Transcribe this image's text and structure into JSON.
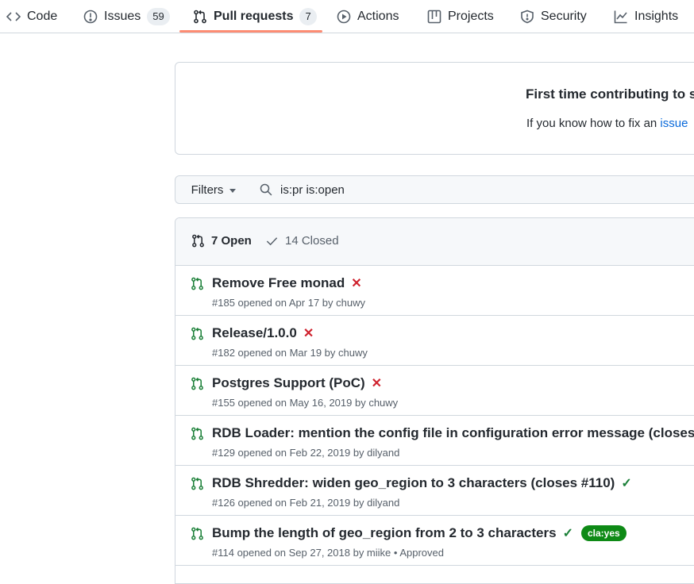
{
  "nav": {
    "tabs": [
      {
        "label": "Code",
        "icon": "code-icon"
      },
      {
        "label": "Issues",
        "icon": "issue-opened-icon",
        "count": "59"
      },
      {
        "label": "Pull requests",
        "icon": "git-pull-request-icon",
        "count": "7",
        "selected": true
      },
      {
        "label": "Actions",
        "icon": "play-icon"
      },
      {
        "label": "Projects",
        "icon": "table-icon"
      },
      {
        "label": "Security",
        "icon": "shield-icon"
      },
      {
        "label": "Insights",
        "icon": "graph-icon"
      }
    ]
  },
  "banner": {
    "title": "First time contributing to s",
    "text_prefix": "If you know how to fix an ",
    "link": "issue"
  },
  "filters": {
    "button_label": "Filters",
    "search_value": "is:pr is:open"
  },
  "list": {
    "open_label": "7 Open",
    "closed_label": "14 Closed",
    "rows": [
      {
        "title": "Remove Free monad",
        "status": "✕",
        "status_kind": "fail",
        "meta": "#185 opened on Apr 17 by chuwy"
      },
      {
        "title": "Release/1.0.0",
        "status": "✕",
        "status_kind": "fail",
        "meta": "#182 opened on Mar 19 by chuwy"
      },
      {
        "title": "Postgres Support (PoC)",
        "status": "✕",
        "status_kind": "fail",
        "meta": "#155 opened on May 16, 2019 by chuwy"
      },
      {
        "title": "RDB Loader: mention the config file in configuration error message (closes",
        "status": "",
        "status_kind": "none",
        "meta": "#129 opened on Feb 22, 2019 by dilyand"
      },
      {
        "title": "RDB Shredder: widen geo_region to 3 characters (closes #110)",
        "status": "✓",
        "status_kind": "ok",
        "meta": "#126 opened on Feb 21, 2019 by dilyand"
      },
      {
        "title": "Bump the length of geo_region from 2 to 3 characters",
        "status": "✓",
        "status_kind": "ok",
        "label": "cla:yes",
        "meta": "#114 opened on Sep 27, 2018 by miike • Approved"
      }
    ]
  },
  "colors": {
    "accent_underline": "#fd8c73",
    "open_green": "#1a7f37",
    "fail_red": "#cf222e",
    "label_green": "#0e8a16",
    "link_blue": "#0969da"
  }
}
